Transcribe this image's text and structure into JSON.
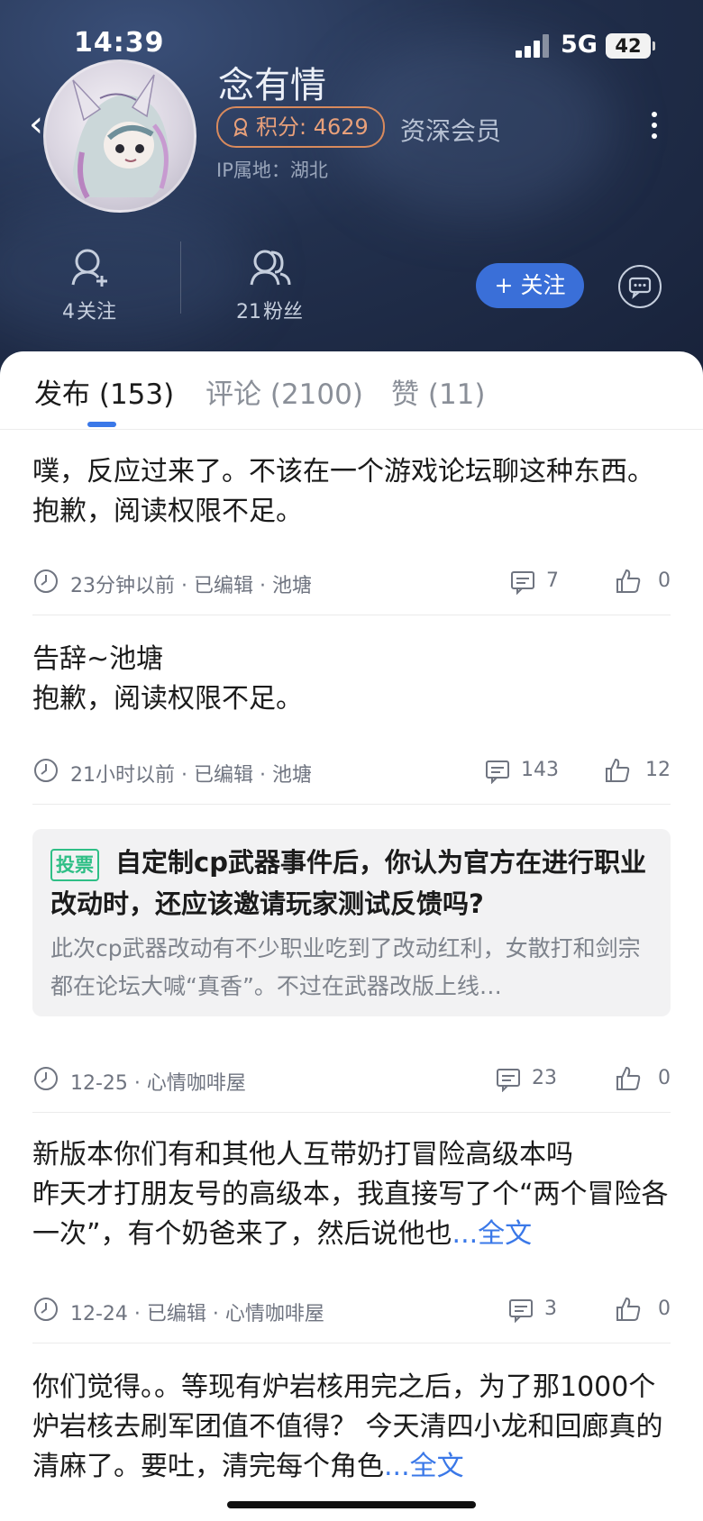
{
  "status_bar": {
    "time": "14:39",
    "network": "5G",
    "battery": "42"
  },
  "profile": {
    "name": "念有情",
    "points_label": "积分: 4629",
    "member_label": "资深会员",
    "ip_label": "IP属地：湖北",
    "following_count": "4",
    "following_label": "关注",
    "fans_count": "21",
    "fans_label": "粉丝",
    "follow_button": "+ 关注"
  },
  "tabs": [
    {
      "label": "发布 (153)",
      "active": true
    },
    {
      "label": "评论 (2100)",
      "active": false
    },
    {
      "label": "赞 (11)",
      "active": false
    }
  ],
  "posts": [
    {
      "title": "噗，反应过来了。不该在一个游戏论坛聊这种东西。 抱歉，阅读权限不足。",
      "meta": "23分钟以前 · 已编辑 · 池塘",
      "comments": "7",
      "likes": "0"
    },
    {
      "title": "告辞~池塘",
      "body": "抱歉，阅读权限不足。",
      "meta": "21小时以前 · 已编辑 · 池塘",
      "comments": "143",
      "likes": "12"
    },
    {
      "vote_tag": "投票",
      "title": "自定制cp武器事件后，你认为官方在进行职业改动时，还应该邀请玩家测试反馈吗?",
      "body": "此次cp武器改动有不少职业吃到了改动红利，女散打和剑宗都在论坛大喊“真香”。不过在武器改版上线…",
      "meta": "12-25 · 心情咖啡屋",
      "comments": "23",
      "likes": "0"
    },
    {
      "title": "新版本你们有和其他人互带奶打冒险高级本吗",
      "body": "  昨天才打朋友号的高级本，我直接写了个“两个冒险各一次”，有个奶爸来了，然后说他也",
      "more": "...全文",
      "meta": "12-24 · 已编辑 · 心情咖啡屋",
      "comments": "3",
      "likes": "0"
    },
    {
      "title": "你们觉得。。等现有炉岩核用完之后，为了那1000个炉岩核去刷军团值不值得？ 今天清四小龙和回廊真的清麻了。要吐，清完每个角色",
      "more": "...全文"
    }
  ]
}
